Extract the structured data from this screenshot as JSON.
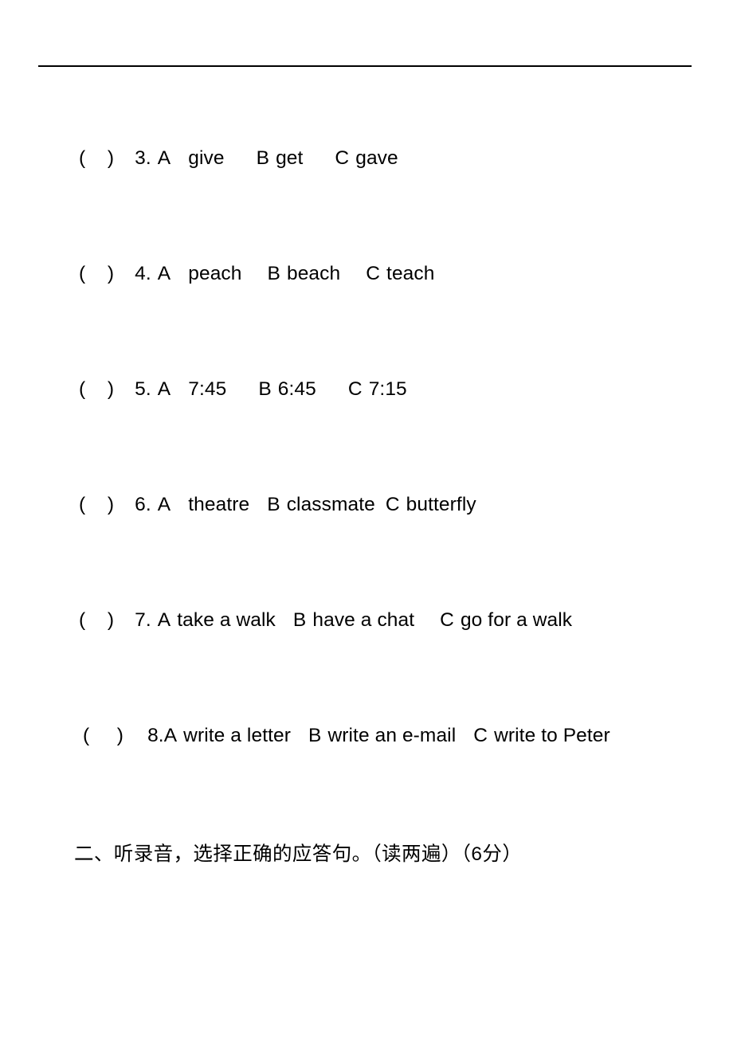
{
  "page": {
    "background_color": "#ffffff",
    "text_color": "#000000",
    "rule_color": "#000000"
  },
  "questions": [
    {
      "blank": "(    )",
      "number": "3.",
      "options": [
        {
          "letter": "A",
          "text": "give"
        },
        {
          "letter": "B",
          "text": "get"
        },
        {
          "letter": "C",
          "text": "gave"
        }
      ]
    },
    {
      "blank": "(    )",
      "number": "4.",
      "options": [
        {
          "letter": "A",
          "text": "peach"
        },
        {
          "letter": "B",
          "text": "beach"
        },
        {
          "letter": "C",
          "text": "teach"
        }
      ]
    },
    {
      "blank": "(    )",
      "number": "5.",
      "options": [
        {
          "letter": "A",
          "text": "7:45"
        },
        {
          "letter": "B",
          "text": "6:45"
        },
        {
          "letter": "C",
          "text": "7:15"
        }
      ]
    },
    {
      "blank": "(    )",
      "number": "6.",
      "options": [
        {
          "letter": "A",
          "text": "theatre"
        },
        {
          "letter": "B",
          "text": "classmate"
        },
        {
          "letter": "C",
          "text": "butterfly"
        }
      ]
    },
    {
      "blank": "(    )",
      "number": "7.",
      "options": [
        {
          "letter": "A",
          "text": "take a walk"
        },
        {
          "letter": "B",
          "text": "have a chat"
        },
        {
          "letter": "C",
          "text": "go for a walk"
        }
      ]
    },
    {
      "blank": "(     )",
      "number": "8.",
      "options": [
        {
          "letter": "A",
          "text": "write a letter"
        },
        {
          "letter": "B",
          "text": "write an e-mail"
        },
        {
          "letter": "C",
          "text": "write to Peter"
        }
      ]
    }
  ],
  "section_heading": {
    "text": "二、听录音，选择正确的应答句。（读两遍）（6分）"
  }
}
